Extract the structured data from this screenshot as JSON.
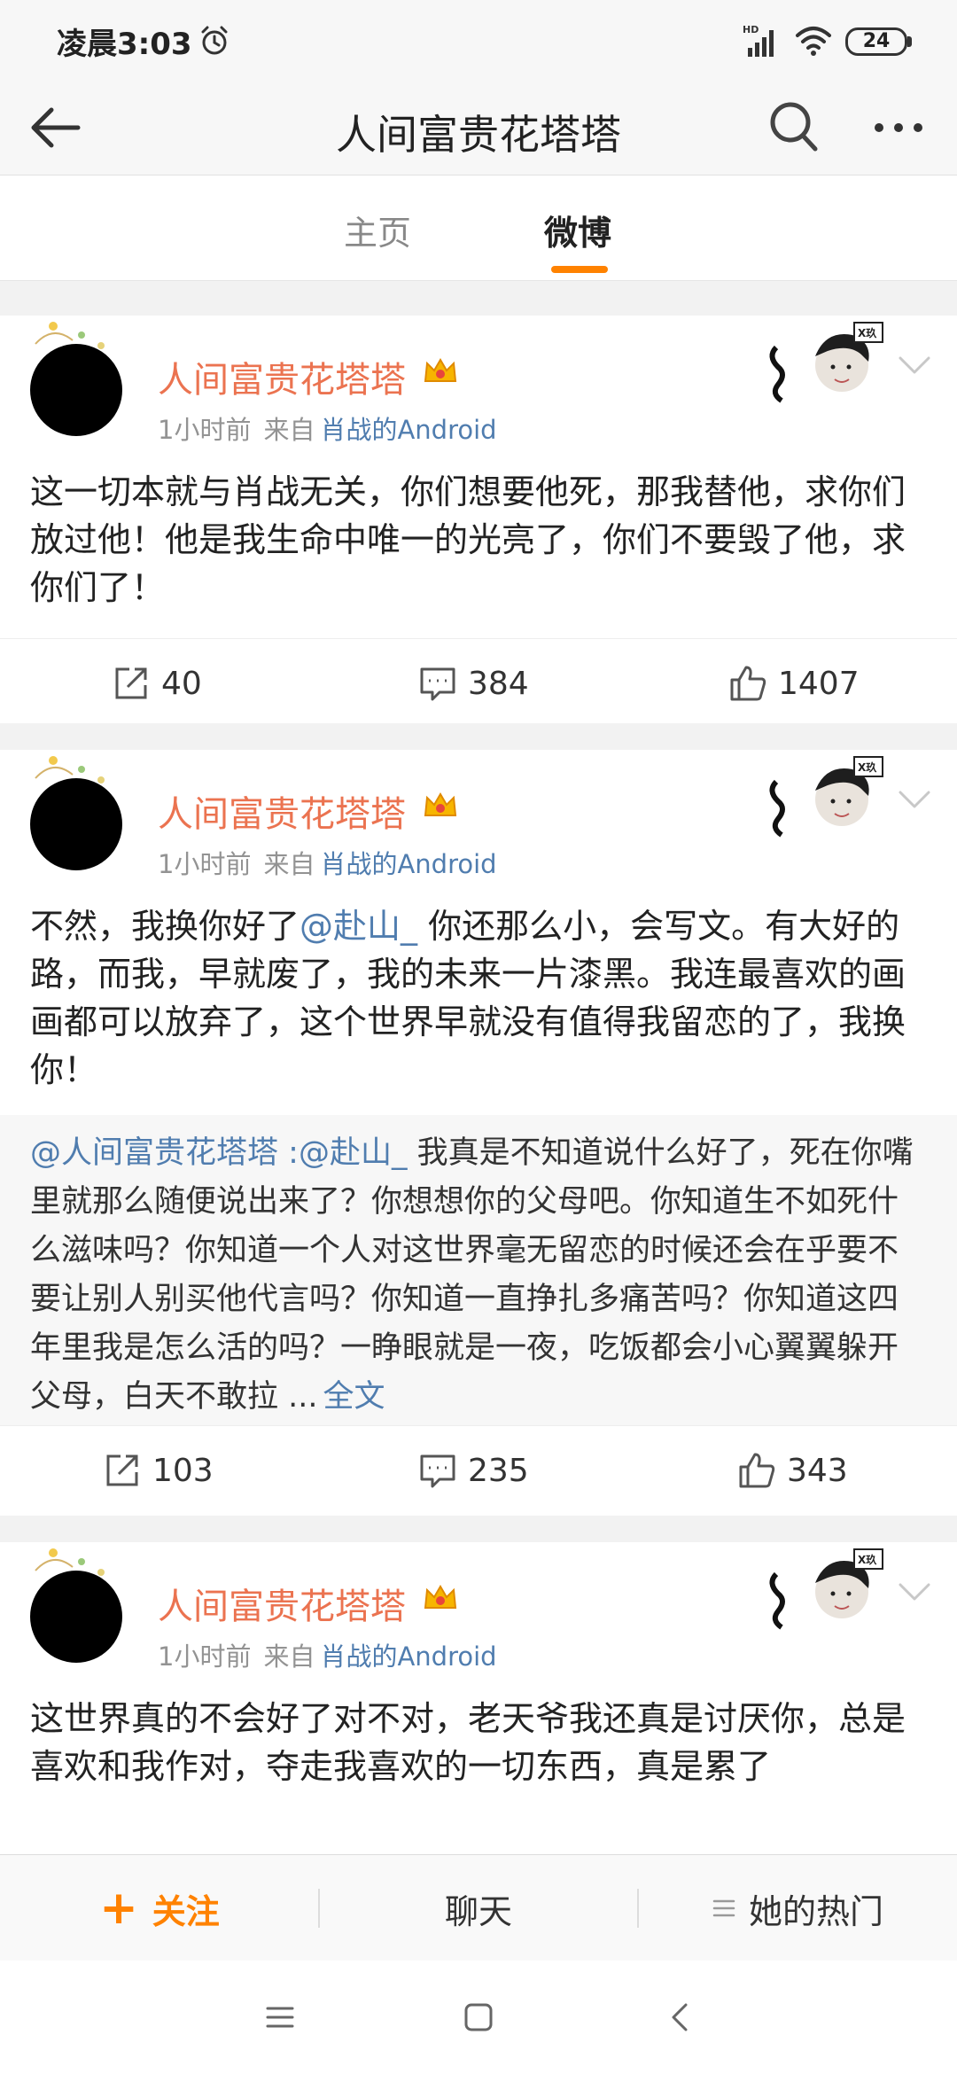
{
  "status_bar": {
    "time": "凌晨3:03",
    "battery": "24",
    "network_label": "HD"
  },
  "nav": {
    "title": "人间富贵花塔塔"
  },
  "tabs": [
    {
      "label": "主页",
      "active": false
    },
    {
      "label": "微博",
      "active": true
    }
  ],
  "colors": {
    "accent": "#ff8200",
    "author": "#eb7350",
    "link": "#507daf",
    "meta": "#939393"
  },
  "posts": [
    {
      "author": "人间富贵花塔塔",
      "time": "1小时前",
      "source_prefix": "来自",
      "source": "肖战的Android",
      "text": "这一切本就与肖战无关，你们想要他死，那我替他，求你们放过他！他是我生命中唯一的光亮了，你们不要毁了他，求你们了！",
      "reposts": "40",
      "comments": "384",
      "likes": "1407"
    },
    {
      "author": "人间富贵花塔塔",
      "time": "1小时前",
      "source_prefix": "来自",
      "source": "肖战的Android",
      "text_prefix": "不然，我换你好了",
      "mention": "@赴山_",
      "text_suffix": " 你还那么小，会写文。有大好的路，而我，早就废了，我的未来一片漆黑。我连最喜欢的画画都可以放弃了，这个世界早就没有值得我留恋的了，我换你！",
      "repost": {
        "author_mention": "@人间富贵花塔塔",
        "separator": " :",
        "mention": "@赴山_",
        "text": " 我真是不知道说什么好了，死在你嘴里就那么随便说出来了？你想想你的父母吧。你知道生不如死什么滋味吗？你知道一个人对这世界毫无留恋的时候还会在乎要不要让别人别买他代言吗？你知道一直挣扎多痛苦吗？你知道这四年里我是怎么活的吗？一睁眼就是一夜，吃饭都会小心翼翼躲开父母，白天不敢拉 ...",
        "more": "全文"
      },
      "reposts": "103",
      "comments": "235",
      "likes": "343"
    },
    {
      "author": "人间富贵花塔塔",
      "time": "1小时前",
      "source_prefix": "来自",
      "source": "肖战的Android",
      "text": "这世界真的不会好了对不对，老天爷我还真是讨厌你，总是喜欢和我作对，夺走我喜欢的一切东西，真是累了"
    }
  ],
  "bottom_bar": {
    "follow": "关注",
    "chat": "聊天",
    "hot": "她的热门"
  }
}
